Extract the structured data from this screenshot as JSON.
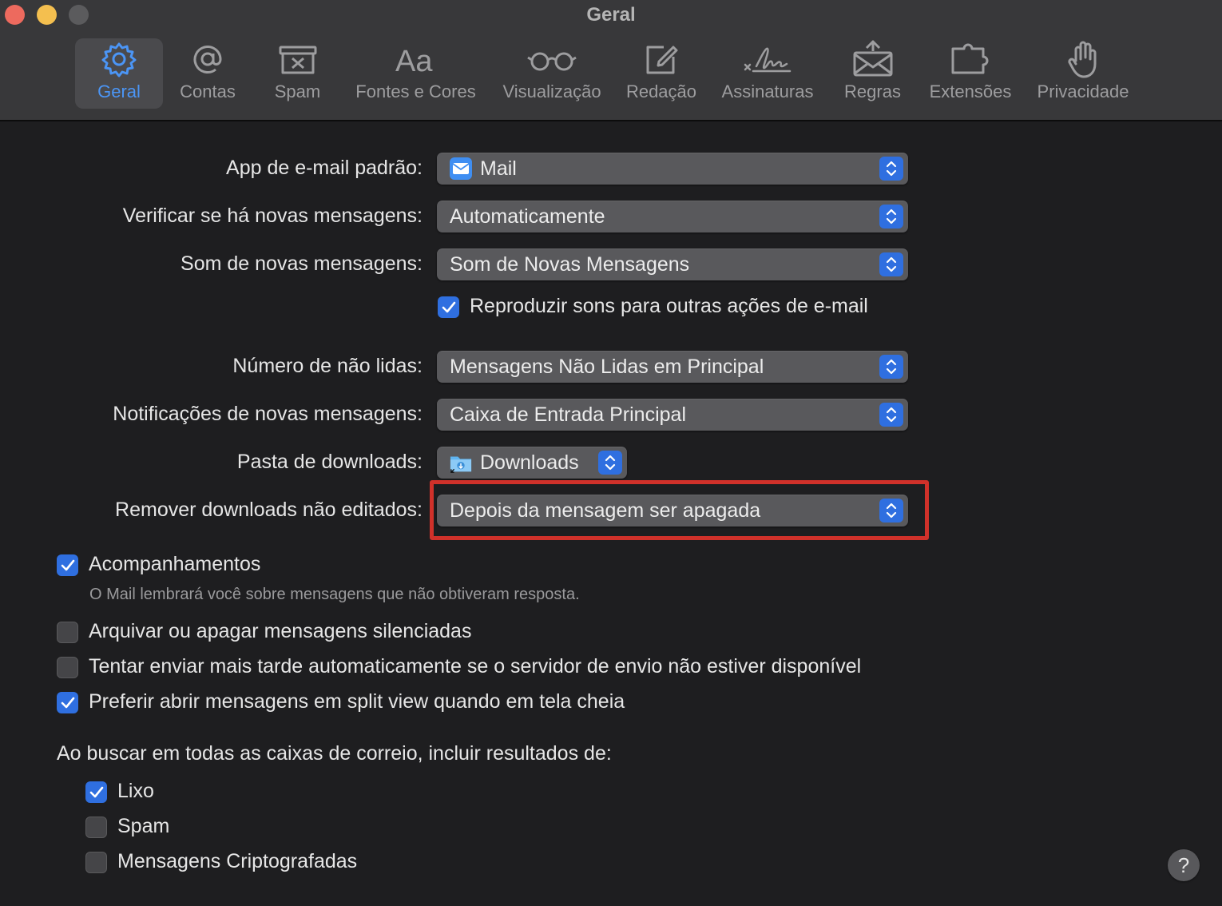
{
  "window": {
    "title": "Geral"
  },
  "toolbar": {
    "tabs": [
      {
        "label": "Geral",
        "icon": "gear-icon",
        "active": true
      },
      {
        "label": "Contas",
        "icon": "at-icon",
        "active": false
      },
      {
        "label": "Spam",
        "icon": "junk-bin-icon",
        "active": false
      },
      {
        "label": "Fontes e Cores",
        "icon": "fonts-icon",
        "active": false
      },
      {
        "label": "Visualização",
        "icon": "glasses-icon",
        "active": false
      },
      {
        "label": "Redação",
        "icon": "compose-icon",
        "active": false
      },
      {
        "label": "Assinaturas",
        "icon": "signature-icon",
        "active": false
      },
      {
        "label": "Regras",
        "icon": "rules-envelope-icon",
        "active": false
      },
      {
        "label": "Extensões",
        "icon": "puzzle-icon",
        "active": false
      },
      {
        "label": "Privacidade",
        "icon": "hand-icon",
        "active": false
      }
    ]
  },
  "settings": {
    "default_app": {
      "label": "App de e-mail padrão:",
      "value": "Mail",
      "icon": "mail-app-icon"
    },
    "check_messages": {
      "label": "Verificar se há novas mensagens:",
      "value": "Automaticamente"
    },
    "new_message_sound": {
      "label": "Som de novas mensagens:",
      "value": "Som de Novas Mensagens"
    },
    "play_sounds": {
      "label": "Reproduzir sons para outras ações de e-mail",
      "checked": true
    },
    "unread_count": {
      "label": "Número de não lidas:",
      "value": "Mensagens Não Lidas em Principal"
    },
    "notifications": {
      "label": "Notificações de novas mensagens:",
      "value": "Caixa de Entrada Principal"
    },
    "downloads_folder": {
      "label": "Pasta de downloads:",
      "value": "Downloads",
      "icon": "downloads-folder-icon"
    },
    "remove_downloads": {
      "label": "Remover downloads não editados:",
      "value": "Depois da mensagem ser apagada"
    },
    "follow_ups": {
      "label": "Acompanhamentos",
      "checked": true,
      "note": "O Mail lembrará você sobre mensagens que não obtiveram resposta."
    },
    "archive_muted": {
      "label": "Arquivar ou apagar mensagens silenciadas",
      "checked": false
    },
    "retry_send": {
      "label": "Tentar enviar mais tarde automaticamente se o servidor de envio não estiver disponível",
      "checked": false
    },
    "split_view": {
      "label": "Preferir abrir mensagens em split view quando em tela cheia",
      "checked": true
    }
  },
  "search": {
    "heading": "Ao buscar em todas as caixas de correio, incluir resultados de:",
    "options": [
      {
        "label": "Lixo",
        "checked": true
      },
      {
        "label": "Spam",
        "checked": false
      },
      {
        "label": "Mensagens Criptografadas",
        "checked": false
      }
    ]
  },
  "help": {
    "label": "?"
  },
  "colors": {
    "accent": "#2f6fe0",
    "active_tab_text": "#4b95f5",
    "highlight": "#d0312a"
  }
}
